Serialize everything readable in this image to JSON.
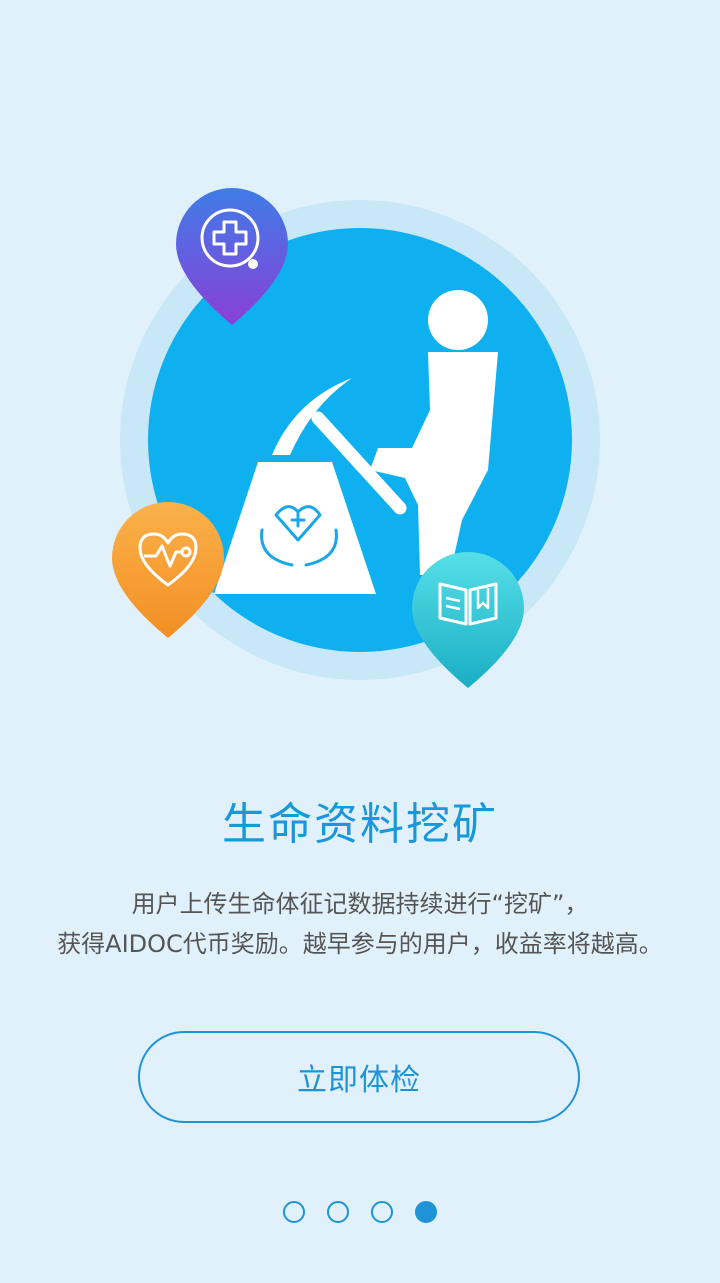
{
  "onboarding": {
    "title": "生命资料挖矿",
    "description_line1": "用户上传生命体征记数据持续进行“挖矿”，",
    "description_line2": "获得AIDOC代币奖励。越早参与的用户，收益率将越高。",
    "cta_label": "立即体检",
    "page_indicator": {
      "current": 4,
      "total": 4
    }
  },
  "colors": {
    "background": "#e1f1fb",
    "accent": "#1e93d6",
    "title": "#1798dc",
    "circle": "#0fb0f0",
    "medical_pin": "#5b4fdc",
    "heart_pin": "#f7a233",
    "book_pin": "#2cc3d2"
  },
  "icons": [
    "medical-cross-icon",
    "heartbeat-icon",
    "book-icon",
    "miner-figure",
    "pickaxe-icon",
    "care-hands-icon"
  ]
}
